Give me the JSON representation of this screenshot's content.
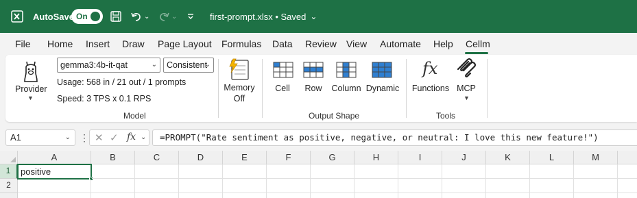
{
  "titlebar": {
    "autosave_label": "AutoSave",
    "autosave_state": "On",
    "doc_title": "first-prompt.xlsx • Saved",
    "icons": [
      "excel-logo",
      "save-icon",
      "undo-icon",
      "redo-icon",
      "customize-qat-icon"
    ]
  },
  "menu": {
    "items": [
      "File",
      "Home",
      "Insert",
      "Draw",
      "Page Layout",
      "Formulas",
      "Data",
      "Review",
      "View",
      "Automate",
      "Help",
      "Cellm"
    ],
    "active": "Cellm"
  },
  "ribbon": {
    "model": {
      "provider_label": "Provider",
      "model_value": "gemma3:4b-it-qat",
      "mode_value": "Consistent",
      "usage": "Usage:  568 in / 21 out / 1 prompts",
      "speed": "Speed:  3 TPS x 0.1 RPS",
      "group_label": "Model"
    },
    "memory": {
      "label_line1": "Memory",
      "label_line2": "Off"
    },
    "output_shape": {
      "buttons": [
        "Cell",
        "Row",
        "Column",
        "Dynamic"
      ],
      "group_label": "Output Shape"
    },
    "tools": {
      "buttons": [
        "Functions",
        "MCP"
      ],
      "group_label": "Tools"
    }
  },
  "formula_bar": {
    "name_box": "A1",
    "formula": "=PROMPT(\"Rate sentiment as positive, negative, or neutral: I love this new feature!\")"
  },
  "sheet": {
    "columns": [
      "A",
      "B",
      "C",
      "D",
      "E",
      "F",
      "G",
      "H",
      "I",
      "J",
      "K",
      "L",
      "M"
    ],
    "rows": [
      "1",
      "2"
    ],
    "cells": {
      "A1": "positive"
    }
  },
  "colors": {
    "accent": "#1e7145",
    "ribbon_bg": "#ffffff",
    "app_bg": "#f3f3f3"
  }
}
